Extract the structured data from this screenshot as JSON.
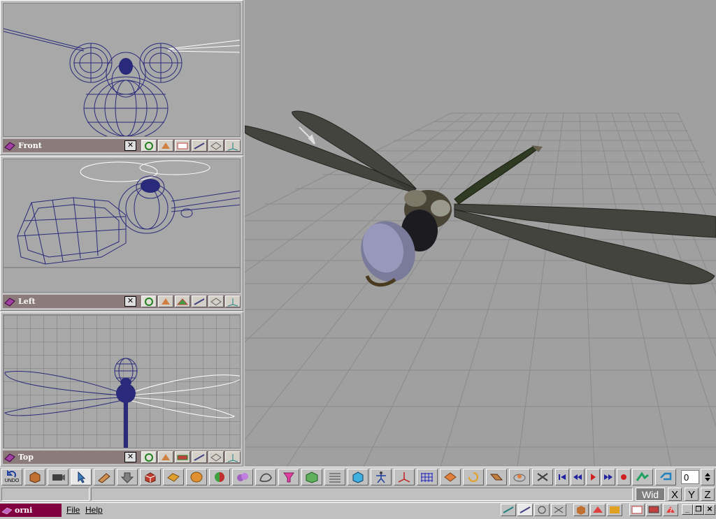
{
  "viewports": {
    "front": {
      "label": "Front",
      "close": "✕"
    },
    "left": {
      "label": "Left",
      "close": "✕"
    },
    "top": {
      "label": "Top",
      "close": "✕"
    },
    "perspective": {
      "label": ""
    }
  },
  "toolbar": {
    "undo_label": "UNDO",
    "frame_value": "0"
  },
  "status": {
    "mode_label": "Wid",
    "axes": [
      "X",
      "Y",
      "Z"
    ]
  },
  "menubar": {
    "app_name": "orni",
    "file_label": "File",
    "help_label": "Help"
  },
  "colors": {
    "wireframe": "#2a2a7a",
    "viewport_bg": "#a8a8a8",
    "title_bar": "#8c7b7b",
    "app_badge": "#800040",
    "perspective_bg": "#a0a0a0"
  }
}
